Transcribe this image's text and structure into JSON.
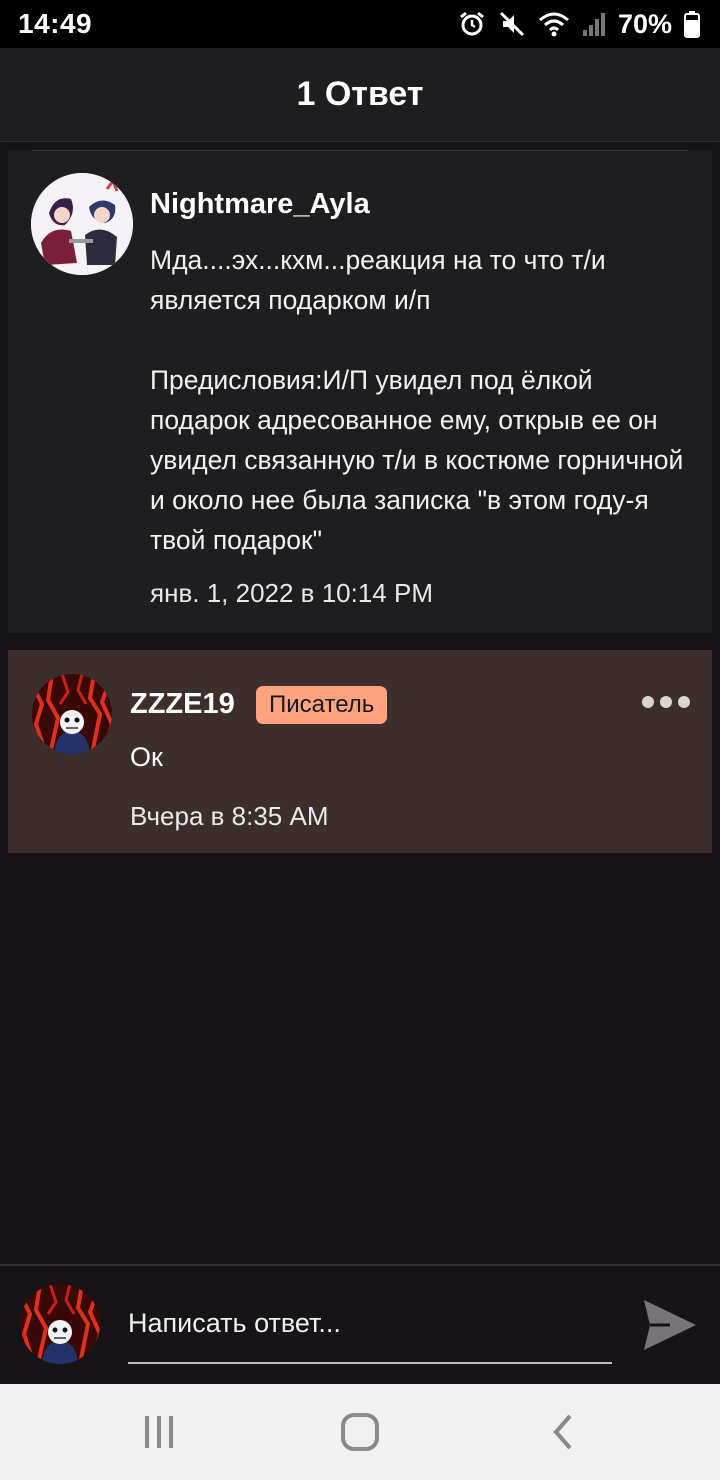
{
  "status_bar": {
    "time": "14:49",
    "battery": "70%",
    "icons": [
      "alarm-icon",
      "mute-icon",
      "wifi-icon",
      "signal-icon",
      "battery-icon"
    ]
  },
  "header": {
    "title": "1 Ответ"
  },
  "comment": {
    "author": "Nightmare_Ayla",
    "text": "Мда....эх...кхм...реакция на то что т/и является подарком и/п\n\nПредисловия:И/П увидел под ёлкой подарок адресованное ему, открыв ее он увидел связанную т/и в костюме горничной и около нее была записка \"в этом году-я твой подарок\"",
    "date": "янв. 1, 2022 в 10:14 PM"
  },
  "reply": {
    "author": "ZZZE19",
    "badge": "Писатель",
    "text": "Ок",
    "date": "Вчера в 8:35 AM"
  },
  "input": {
    "placeholder": "Написать ответ..."
  },
  "colors": {
    "background": "#161416",
    "card": "#1e1d1f",
    "reply_card": "#3b2e2b",
    "badge": "#ffa27f",
    "nav_bar": "#f1f1f1"
  },
  "nav": [
    "recent-apps-icon",
    "home-icon",
    "back-icon"
  ]
}
